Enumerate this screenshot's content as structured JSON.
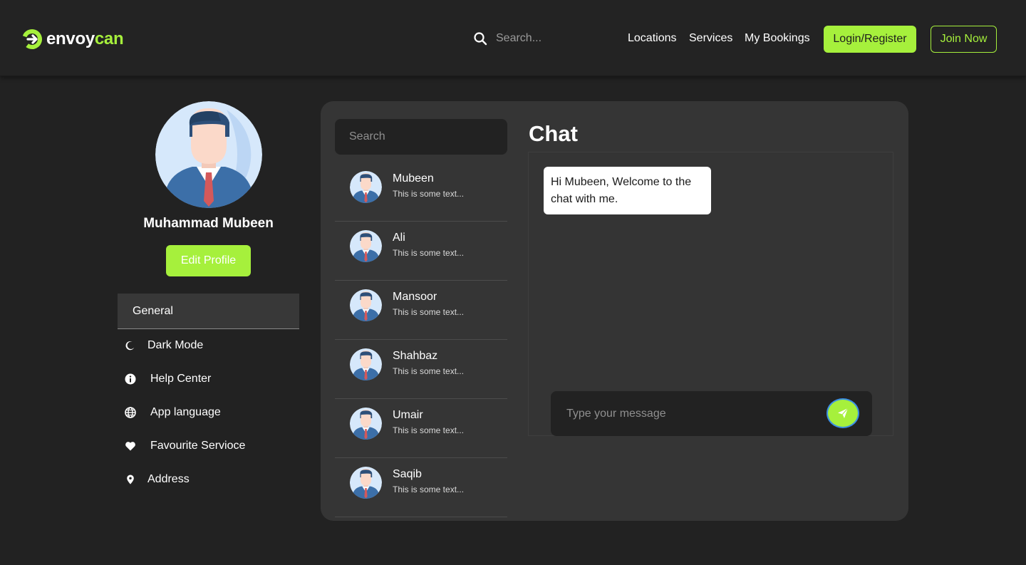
{
  "header": {
    "logo": {
      "word1": "envoy",
      "word2": "can",
      "icon": "envoycan-logo-icon"
    },
    "search": {
      "placeholder": "Search...",
      "icon": "search-icon"
    },
    "nav": [
      {
        "label": "Locations"
      },
      {
        "label": "Services"
      },
      {
        "label": "My Bookings"
      }
    ],
    "login_label": "Login/Register",
    "join_label": "Join Now"
  },
  "profile": {
    "name": "Muhammad Mubeen",
    "edit_label": "Edit Profile",
    "avatar_icon": "user-avatar-icon"
  },
  "settings": {
    "section_label": "General",
    "items": [
      {
        "label": "Dark Mode",
        "icon": "moon-icon"
      },
      {
        "label": "Help Center",
        "icon": "info-icon"
      },
      {
        "label": "App language",
        "icon": "globe-icon"
      },
      {
        "label": "Favourite Servioce",
        "icon": "heart-icon"
      },
      {
        "label": "Address",
        "icon": "location-pin-icon"
      }
    ]
  },
  "contacts": {
    "search_placeholder": "Search",
    "items": [
      {
        "name": "Mubeen",
        "preview": "This is some text..."
      },
      {
        "name": "Ali",
        "preview": "This is some text..."
      },
      {
        "name": "Mansoor",
        "preview": "This is some text..."
      },
      {
        "name": "Shahbaz",
        "preview": "This is some text..."
      },
      {
        "name": "Umair",
        "preview": "This is some text..."
      },
      {
        "name": "Saqib",
        "preview": "This is some text..."
      }
    ]
  },
  "chat": {
    "title": "Chat",
    "messages": [
      {
        "text": "Hi Mubeen, Welcome to the chat with me."
      }
    ],
    "input_placeholder": "Type your message",
    "send_icon": "send-icon"
  },
  "colors": {
    "accent": "#a6f03c",
    "background": "#222222",
    "panel": "#353535",
    "header": "#232323"
  }
}
